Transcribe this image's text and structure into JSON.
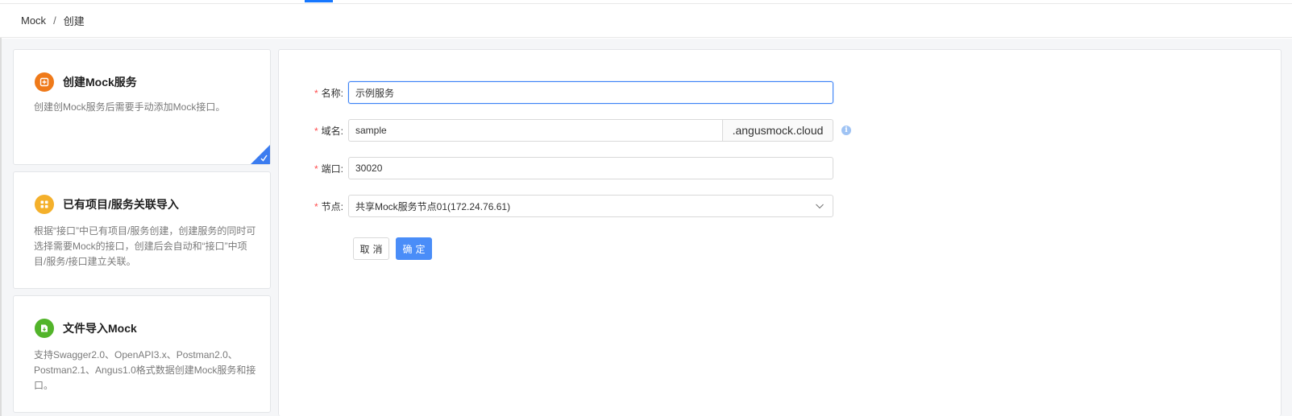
{
  "breadcrumb": {
    "root": "Mock",
    "separator": "/",
    "current": "创建"
  },
  "cards": [
    {
      "title": "创建Mock服务",
      "desc": "创建创Mock服务后需要手动添加Mock接口。",
      "icon": "plus-square-icon",
      "color": "#ef7a1a",
      "selected": true
    },
    {
      "title": "已有项目/服务关联导入",
      "desc": "根据“接口”中已有项目/服务创建，创建服务的同时可选择需要Mock的接口，创建后会自动和“接口”中项目/服务/接口建立关联。",
      "icon": "grid-icon",
      "color": "#f4b02b",
      "selected": false
    },
    {
      "title": "文件导入Mock",
      "desc": "支持Swagger2.0、OpenAPI3.x、Postman2.0、Postman2.1、Angus1.0格式数据创建Mock服务和接口。",
      "icon": "file-import-icon",
      "color": "#52b42a",
      "selected": false
    }
  ],
  "form": {
    "required_mark": "*",
    "name": {
      "label": "名称:",
      "value": "示例服务"
    },
    "domain": {
      "label": "域名:",
      "value": "sample",
      "suffix": ".angusmock.cloud"
    },
    "port": {
      "label": "端口:",
      "value": "30020"
    },
    "node": {
      "label": "节点:",
      "value": "共享Mock服务节点01(172.24.76.61)"
    },
    "cancel_label": "取消",
    "ok_label": "确定"
  },
  "colors": {
    "accent": "#4a8df8",
    "required": "#ff4d4f"
  }
}
